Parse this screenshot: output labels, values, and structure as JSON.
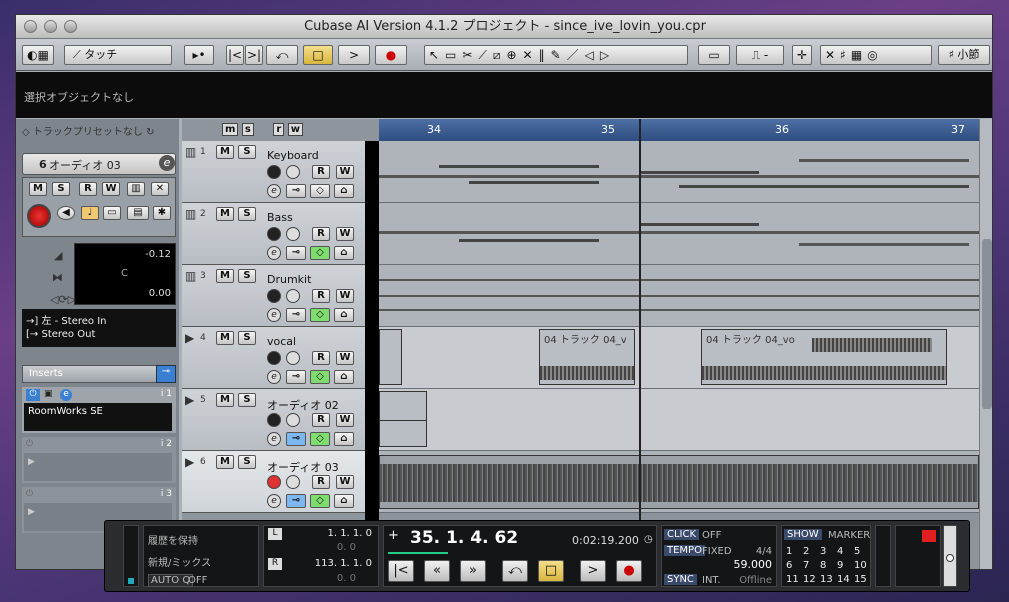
{
  "window": {
    "title": "Cubase AI Version 4.1.2 プロジェクト - since_ive_lovin_you.cpr"
  },
  "toolbar": {
    "automation_mode": "タッチ",
    "snap_label": "小節"
  },
  "infoline": {
    "text": "選択オブジェクトなし"
  },
  "inspector": {
    "preset_label": "トラックプリセットなし",
    "track_number": "6",
    "track_name": "オーディオ 03",
    "volume": "-0.12",
    "pan": "C",
    "delay": "0.00",
    "input": "左 - Stereo In",
    "output": "Stereo Out",
    "inserts_label": "Inserts",
    "insert_slots": [
      {
        "index": "i 1",
        "name": "RoomWorks SE"
      },
      {
        "index": "i 2",
        "name": ""
      },
      {
        "index": "i 3",
        "name": ""
      }
    ],
    "buttons": {
      "mute": "M",
      "solo": "S",
      "read": "R",
      "write": "W"
    }
  },
  "track_header_toolbar": [
    "m",
    "s",
    "r",
    "w"
  ],
  "tracks": [
    {
      "num": "1",
      "name": "Keyboard",
      "type": "midi"
    },
    {
      "num": "2",
      "name": "Bass",
      "type": "midi"
    },
    {
      "num": "3",
      "name": "Drumkit",
      "type": "midi"
    },
    {
      "num": "4",
      "name": "vocal",
      "type": "audio"
    },
    {
      "num": "5",
      "name": "オーディオ 02",
      "type": "audio"
    },
    {
      "num": "6",
      "name": "オーディオ 03",
      "type": "audio"
    }
  ],
  "track_buttons": {
    "mute": "M",
    "solo": "S",
    "read": "R",
    "write": "W",
    "edit": "e"
  },
  "ruler": {
    "bars": [
      "34",
      "35",
      "36",
      "37"
    ]
  },
  "parts": {
    "vocal_1": "04 トラック 04_v",
    "vocal_2": "04 トラック 04_vo"
  },
  "transport": {
    "history_keep": "履歴を保持",
    "new_mix": "新規/ミックス",
    "autoq_label": "AUTO Q",
    "autoq_value": "OFF",
    "left_locator": "1. 1. 1.  0",
    "left_sub": "0.  0",
    "right_locator": "113. 1. 1.  0",
    "right_sub": "0.  0",
    "locator_l": "L",
    "locator_r": "R",
    "position_bars": "35.  1.  4.  62",
    "position_time": "0:02:19.200",
    "plus": "+",
    "click_label": "CLICK",
    "click_value": "OFF",
    "tempo_label": "TEMPO",
    "tempo_mode": "FIXED",
    "signature": "4/4",
    "tempo_value": "59.000",
    "sync_label": "SYNC",
    "sync_value": "INT.",
    "sync_state": "Offline",
    "show_label": "SHOW",
    "marker_label": "MARKER",
    "markers": [
      "1",
      "2",
      "3",
      "4",
      "5",
      "6",
      "7",
      "8",
      "9",
      "10",
      "11",
      "12",
      "13",
      "14",
      "15"
    ]
  }
}
